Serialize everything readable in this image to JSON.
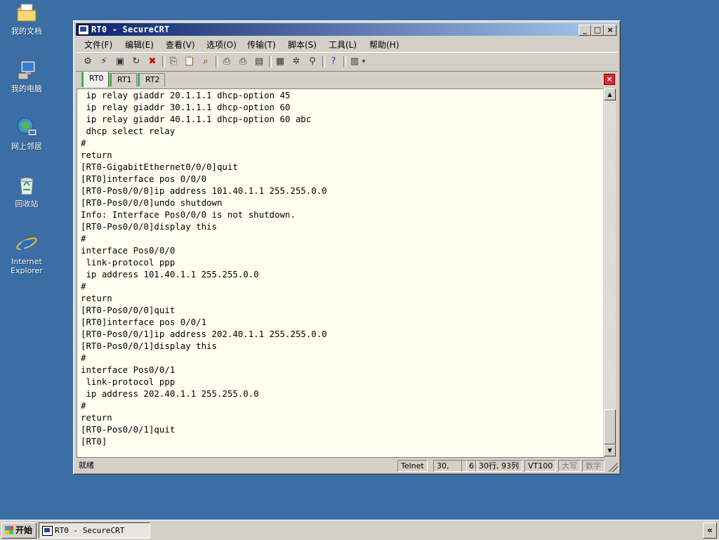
{
  "desktop": {
    "icons": [
      {
        "label": "我的文档",
        "icon": "my-documents-icon"
      },
      {
        "label": "我的电脑",
        "icon": "my-computer-icon"
      },
      {
        "label": "网上邻居",
        "icon": "network-places-icon"
      },
      {
        "label": "回收站",
        "icon": "recycle-bin-icon"
      },
      {
        "label": "Internet\nExplorer",
        "icon": "internet-explorer-icon"
      }
    ]
  },
  "window": {
    "title": "RT0 - SecureCRT",
    "controls": {
      "minimize": "_",
      "maximize": "□",
      "close": "×"
    },
    "menu": [
      "文件(F)",
      "编辑(E)",
      "查看(V)",
      "选项(O)",
      "传输(T)",
      "脚本(S)",
      "工具(L)",
      "帮助(H)"
    ],
    "tabs": [
      {
        "label": "RT0",
        "active": true
      },
      {
        "label": "RT1",
        "active": false
      },
      {
        "label": "RT2",
        "active": false
      }
    ],
    "tab_close": "×",
    "terminal_lines": [
      " ip relay giaddr 20.1.1.1 dhcp-option 45",
      " ip relay giaddr 30.1.1.1 dhcp-option 60",
      " ip relay giaddr 40.1.1.1 dhcp-option 60 abc",
      " dhcp select relay",
      "#",
      "return",
      "[RT0-GigabitEthernet0/0/0]quit",
      "[RT0]interface pos 0/0/0",
      "[RT0-Pos0/0/0]ip address 101.40.1.1 255.255.0.0",
      "[RT0-Pos0/0/0]undo shutdown",
      "Info: Interface Pos0/0/0 is not shutdown.",
      "[RT0-Pos0/0/0]display this",
      "#",
      "interface Pos0/0/0",
      " link-protocol ppp",
      " ip address 101.40.1.1 255.255.0.0",
      "#",
      "return",
      "[RT0-Pos0/0/0]quit",
      "[RT0]interface pos 0/0/1",
      "[RT0-Pos0/0/1]ip address 202.40.1.1 255.255.0.0",
      "[RT0-Pos0/0/1]display this",
      "#",
      "interface Pos0/0/1",
      " link-protocol ppp",
      " ip address 202.40.1.1 255.255.0.0",
      "#",
      "return",
      "[RT0-Pos0/0/1]quit",
      "[RT0]"
    ],
    "status": {
      "ready": "就绪",
      "protocol": "Telnet",
      "cursor_row": "30,",
      "cursor_col": "6",
      "size": "30行, 93列",
      "emulation": "VT100",
      "caps": "大写",
      "num": "数字"
    }
  },
  "taskbar": {
    "start_label": "开始",
    "task_label": "RT0 - SecureCRT",
    "tray_label": "«"
  }
}
